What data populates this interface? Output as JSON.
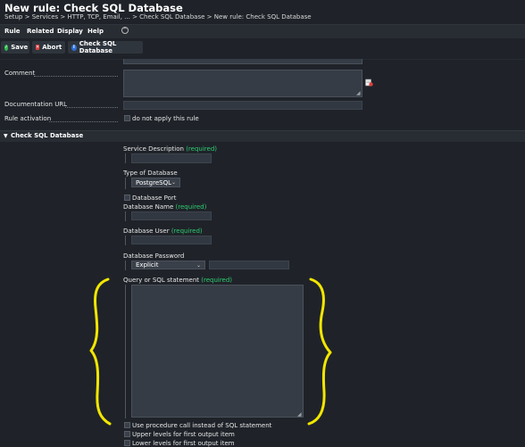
{
  "header": {
    "title": "New rule: Check SQL Database",
    "breadcrumb": "Setup > Services > HTTP, TCP, Email, ... > Check SQL Database > New rule: Check SQL Database"
  },
  "menu": {
    "items": [
      "Rule",
      "Related",
      "Display",
      "Help"
    ],
    "toggle_icon": "chevron-up-icon"
  },
  "toolbar": {
    "save_label": "Save",
    "abort_label": "Abort",
    "check_label": "Check SQL Database"
  },
  "rule_properties": {
    "comment_label": "Comment",
    "comment_value": "",
    "documentation_url_label": "Documentation URL",
    "documentation_url_value": "",
    "rule_activation_label": "Rule activation",
    "rule_activation_option": "do not apply this rule"
  },
  "section": {
    "title": "Check SQL Database"
  },
  "form": {
    "service_description_label": "Service Description",
    "required_text": "(required)",
    "type_of_database_label": "Type of Database",
    "type_of_database_value": "PostgreSQL",
    "database_port_label": "Database Port",
    "database_name_label": "Database Name",
    "database_user_label": "Database User",
    "database_password_label": "Database Password",
    "database_password_mode": "Explicit",
    "query_label": "Query or SQL statement",
    "use_procedure_label": "Use procedure call instead of SQL statement",
    "upper_levels_label": "Upper levels for first output item",
    "lower_levels_label": "Lower levels for first output item"
  },
  "colors": {
    "required": "#2ecc71",
    "annotation": "#f2e600",
    "save_icon": "#2ebd4e",
    "abort_icon": "#e23c3c",
    "check_icon": "#2e6fd8"
  }
}
